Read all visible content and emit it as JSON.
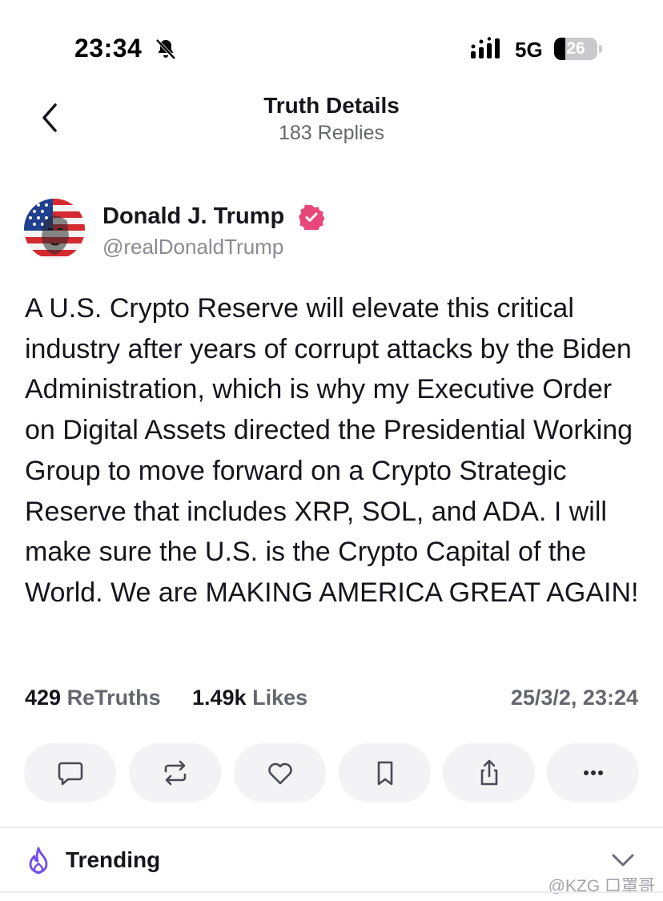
{
  "status_bar": {
    "time": "23:34",
    "network": "5G",
    "battery_level": "26",
    "battery_fraction": 0.26
  },
  "header": {
    "title": "Truth Details",
    "subtitle": "183 Replies"
  },
  "post": {
    "author_name": "Donald J. Trump",
    "author_handle": "@realDonaldTrump",
    "text": "A U.S. Crypto Reserve will elevate this critical industry after years of corrupt attacks by the Biden Administration, which is why my Executive Order on Digital Assets directed the Presidential Working Group to move forward on a Crypto Strategic Reserve that includes XRP, SOL, and ADA. I will make sure the U.S. is the Crypto Capital of the World. We are MAKING AMERICA GREAT AGAIN!",
    "retruths_count": "429",
    "retruths_label": "ReTruths",
    "likes_count": "1.49k",
    "likes_label": "Likes",
    "date": "25/3/2, 23:24"
  },
  "actions": [
    {
      "name": "reply-button",
      "icon": "comment-icon"
    },
    {
      "name": "retruth-button",
      "icon": "repost-icon"
    },
    {
      "name": "like-button",
      "icon": "heart-icon"
    },
    {
      "name": "bookmark-button",
      "icon": "bookmark-icon"
    },
    {
      "name": "share-button",
      "icon": "share-icon"
    },
    {
      "name": "more-button",
      "icon": "ellipsis-icon"
    }
  ],
  "trending": {
    "label": "Trending"
  },
  "watermark": "@KZG 口罩哥",
  "colors": {
    "text": "#16151c",
    "muted": "#66666e",
    "handle": "#8b8a94",
    "verified": "#e8477a",
    "trending_icon": "#6f4cf0",
    "button_bg": "#f3f3f5"
  }
}
